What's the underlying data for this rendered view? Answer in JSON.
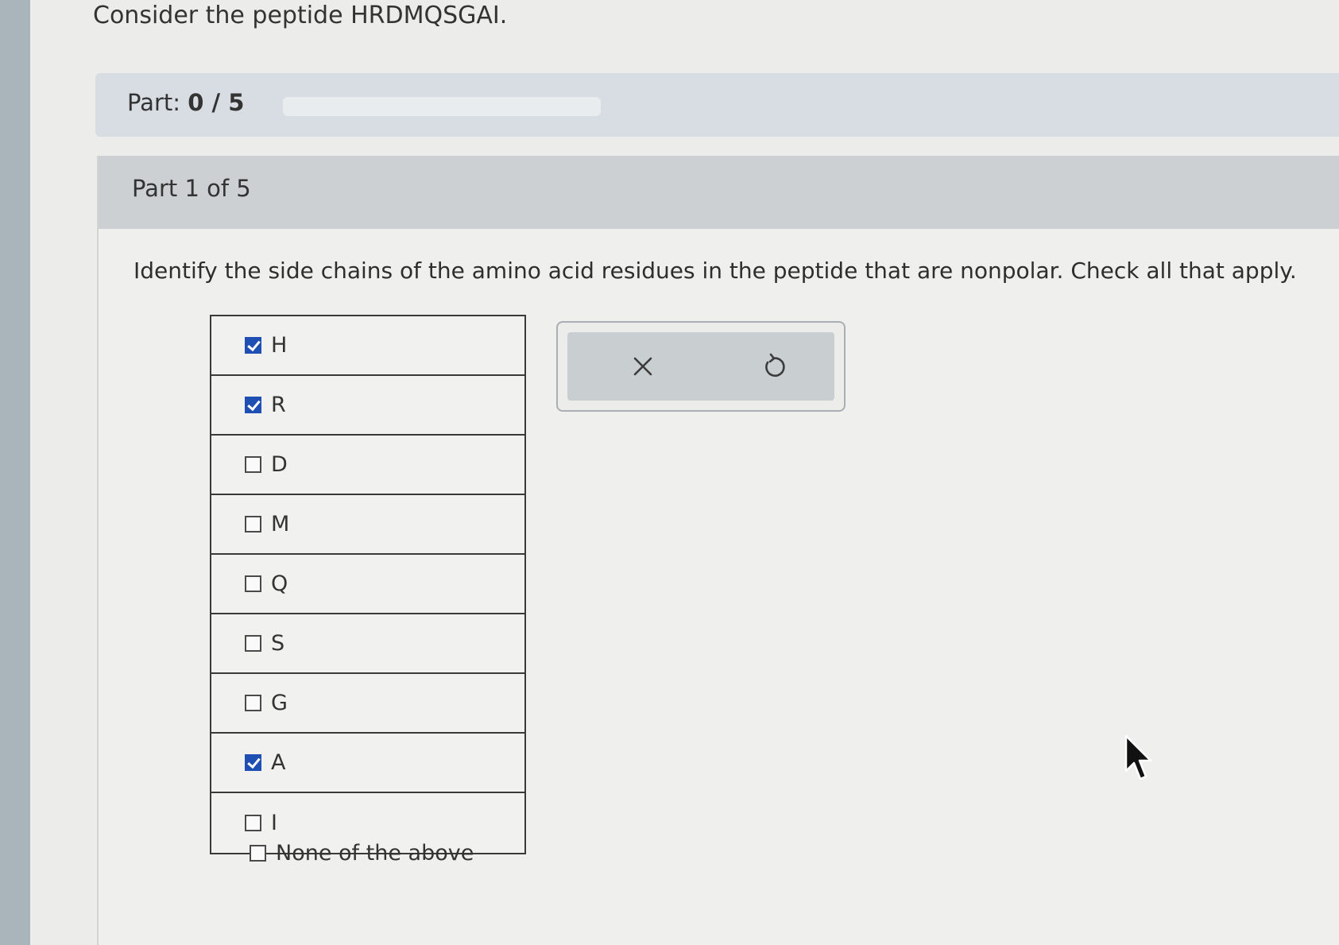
{
  "question": {
    "title": "Consider the peptide HRDMQSGAI."
  },
  "progress": {
    "label": "Part:",
    "current": "0",
    "separator": "/",
    "total": "5",
    "fraction": 0
  },
  "part": {
    "header": "Part 1 of 5",
    "prompt": "Identify the side chains of the amino acid residues in the peptide that are nonpolar. Check all that apply."
  },
  "choices": [
    {
      "label": "H",
      "checked": true
    },
    {
      "label": "R",
      "checked": true
    },
    {
      "label": "D",
      "checked": false
    },
    {
      "label": "M",
      "checked": false
    },
    {
      "label": "Q",
      "checked": false
    },
    {
      "label": "S",
      "checked": false
    },
    {
      "label": "G",
      "checked": false
    },
    {
      "label": "A",
      "checked": true
    },
    {
      "label": "I",
      "checked": false
    }
  ],
  "none_option": {
    "label": "None of the above",
    "checked": false
  },
  "actions": {
    "clear_icon": "close-icon",
    "undo_icon": "undo-icon"
  },
  "colors": {
    "accent": "#1f4fb3",
    "panel": "#ccd0d2"
  }
}
